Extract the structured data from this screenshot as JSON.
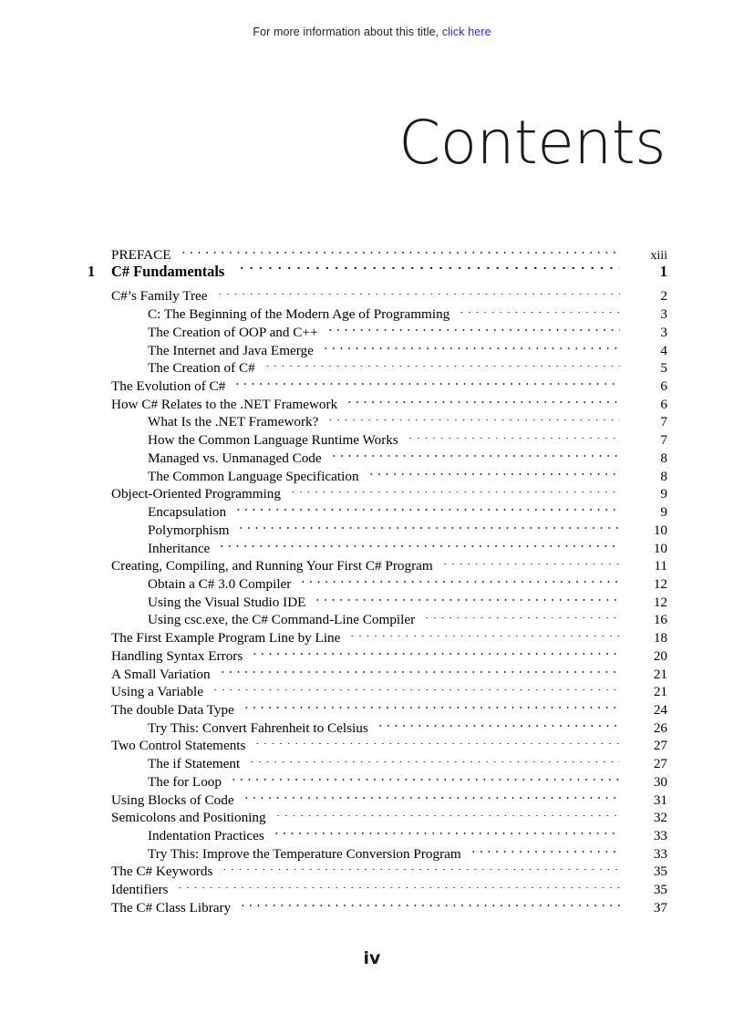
{
  "banner": {
    "text": "For more information about this title,",
    "link_label": "click here",
    "link_color": "#3333cc"
  },
  "page": {
    "title": "Contents",
    "folio": "iv"
  },
  "toc": {
    "rows": [
      {
        "level": "preface",
        "chapter": "",
        "title": "PREFACE",
        "page": "xiii"
      },
      {
        "level": "chapter",
        "chapter": "1",
        "title": "C# Fundamentals",
        "page": "1"
      },
      {
        "level": "1",
        "chapter": "",
        "title": "C#’s Family Tree",
        "page": "2"
      },
      {
        "level": "2",
        "chapter": "",
        "title": "C: The Beginning of the Modern Age of Programming",
        "page": "3"
      },
      {
        "level": "2",
        "chapter": "",
        "title": "The Creation of OOP and C++",
        "page": "3"
      },
      {
        "level": "2",
        "chapter": "",
        "title": "The Internet and Java Emerge",
        "page": "4"
      },
      {
        "level": "2",
        "chapter": "",
        "title": "The Creation of C#",
        "page": "5"
      },
      {
        "level": "1",
        "chapter": "",
        "title": "The Evolution of C#",
        "page": "6"
      },
      {
        "level": "1",
        "chapter": "",
        "title": "How C# Relates to the .NET Framework",
        "page": "6"
      },
      {
        "level": "2",
        "chapter": "",
        "title": "What Is the .NET Framework?",
        "page": "7"
      },
      {
        "level": "2",
        "chapter": "",
        "title": "How the Common Language Runtime Works",
        "page": "7"
      },
      {
        "level": "2",
        "chapter": "",
        "title": "Managed vs. Unmanaged Code",
        "page": "8"
      },
      {
        "level": "2",
        "chapter": "",
        "title": "The Common Language Specification",
        "page": "8"
      },
      {
        "level": "1",
        "chapter": "",
        "title": "Object-Oriented Programming",
        "page": "9"
      },
      {
        "level": "2",
        "chapter": "",
        "title": "Encapsulation",
        "page": "9"
      },
      {
        "level": "2",
        "chapter": "",
        "title": "Polymorphism",
        "page": "10"
      },
      {
        "level": "2",
        "chapter": "",
        "title": "Inheritance",
        "page": "10"
      },
      {
        "level": "1",
        "chapter": "",
        "title": "Creating, Compiling, and Running Your First C# Program",
        "page": "11"
      },
      {
        "level": "2",
        "chapter": "",
        "title": "Obtain a C# 3.0 Compiler",
        "page": "12"
      },
      {
        "level": "2",
        "chapter": "",
        "title": "Using the Visual Studio IDE",
        "page": "12"
      },
      {
        "level": "2",
        "chapter": "",
        "title": "Using csc.exe, the C# Command-Line Compiler",
        "page": "16"
      },
      {
        "level": "1",
        "chapter": "",
        "title": "The First Example Program Line by Line",
        "page": "18"
      },
      {
        "level": "1",
        "chapter": "",
        "title": "Handling Syntax Errors",
        "page": "20"
      },
      {
        "level": "1",
        "chapter": "",
        "title": "A Small Variation",
        "page": "21"
      },
      {
        "level": "1",
        "chapter": "",
        "title": "Using a Variable",
        "page": "21"
      },
      {
        "level": "1",
        "chapter": "",
        "title": "The double Data Type",
        "page": "24"
      },
      {
        "level": "2",
        "chapter": "",
        "title": "Try This: Convert Fahrenheit to Celsius",
        "page": "26"
      },
      {
        "level": "1",
        "chapter": "",
        "title": "Two Control Statements",
        "page": "27"
      },
      {
        "level": "2",
        "chapter": "",
        "title": "The if Statement",
        "page": "27"
      },
      {
        "level": "2",
        "chapter": "",
        "title": "The for Loop",
        "page": "30"
      },
      {
        "level": "1",
        "chapter": "",
        "title": "Using Blocks of Code",
        "page": "31"
      },
      {
        "level": "1",
        "chapter": "",
        "title": "Semicolons and Positioning",
        "page": "32"
      },
      {
        "level": "2",
        "chapter": "",
        "title": "Indentation Practices",
        "page": "33"
      },
      {
        "level": "2",
        "chapter": "",
        "title": "Try This: Improve the Temperature Conversion Program",
        "page": "33"
      },
      {
        "level": "1",
        "chapter": "",
        "title": "The C# Keywords",
        "page": "35"
      },
      {
        "level": "1",
        "chapter": "",
        "title": "Identifiers",
        "page": "35"
      },
      {
        "level": "1",
        "chapter": "",
        "title": "The C# Class Library",
        "page": "37"
      }
    ]
  }
}
